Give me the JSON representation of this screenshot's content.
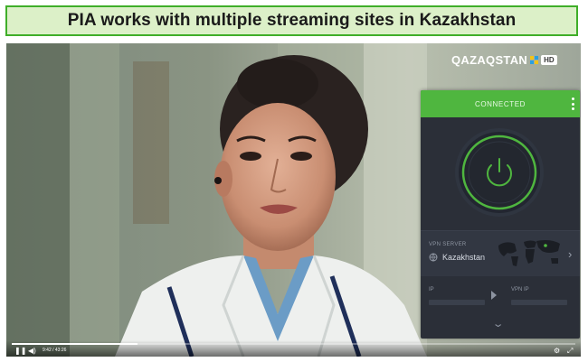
{
  "banner": {
    "title": "PIA works with multiple streaming sites in Kazakhstan"
  },
  "channel": {
    "name": "QAZAQSTAN",
    "badge": "HD"
  },
  "vpn": {
    "status": "CONNECTED",
    "server_label": "VPN SERVER",
    "server_value": "Kazakhstan",
    "ip_label": "IP",
    "vpn_ip_label": "VPN IP"
  },
  "player": {
    "time": "9:42 / 43:26",
    "progress": 0.223
  },
  "colors": {
    "accent_green": "#4fb63f",
    "banner_border": "#3fae29",
    "banner_bg": "#dcf0c8",
    "panel_bg": "#2b2f38"
  },
  "icons": {
    "power": "power-icon",
    "menu": "vertical-ellipsis-icon",
    "server": "globe-icon",
    "map": "world-map-icon",
    "arrow": "chevron-right-icon",
    "expand": "chevron-down-icon",
    "play": "pause-icon",
    "volume": "volume-icon",
    "settings": "gear-icon",
    "fullscreen": "fullscreen-icon"
  }
}
